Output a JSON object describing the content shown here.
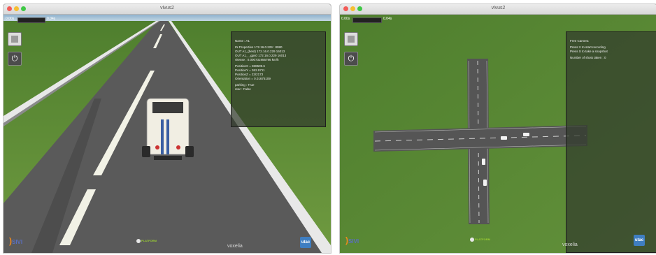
{
  "colors": {
    "grass": "#5f8b3a",
    "road": "#5a5a5a",
    "panel_bg": "#323c2d",
    "accent_orange": "#f08b1e"
  },
  "left": {
    "window_title": "vivus2",
    "sim_time_left": "0.00s",
    "sim_time_right": "0.04s",
    "panel": {
      "name": "Name : A1",
      "line_props": "IN Properties 172.16.0.229 : 8080",
      "line_out1": "OUT A1_(best) 172.16.0.229 16013",
      "line_out2": "OUT A1_ _gps0 172.16.0.229 16013",
      "line_vitesse": "vitesse : 0.000731956796 km/h",
      "pos_x": "PositionX = 838509.6",
      "pos_y": "PositionY = 362.9711",
      "pos_z": "PositionZ = 23/2173",
      "orientation": "Orientation = 0.01675109",
      "parking": "parking : True",
      "rear": "rear : False"
    },
    "logos": {
      "sivic": "SIVI",
      "platform": "PLATFORM",
      "voxelia": "voxelia",
      "utac": "utac"
    }
  },
  "right": {
    "window_title": "vivus2",
    "sim_time_left": "0.00s",
    "sim_time_right": "0.04s",
    "panel": {
      "title": "Free Camera",
      "line1": "Press V to start recording",
      "line2": "Press S to take a snapshot",
      "line3": "Number of shots taken : 0"
    },
    "logos": {
      "sivic": "SIVI",
      "platform": "PLATFORM",
      "voxelia": "voxelia",
      "utac": "utac"
    }
  }
}
